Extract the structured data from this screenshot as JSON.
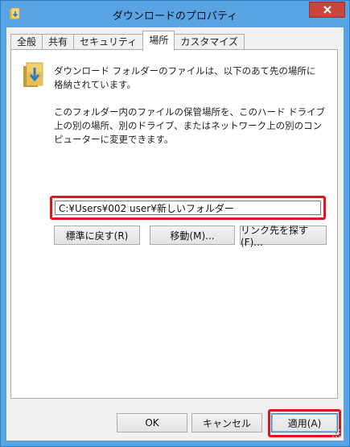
{
  "window": {
    "title": "ダウンロードのプロパティ"
  },
  "tabs": [
    {
      "label": "全般"
    },
    {
      "label": "共有"
    },
    {
      "label": "セキュリティ"
    },
    {
      "label": "場所"
    },
    {
      "label": "カスタマイズ"
    }
  ],
  "active_tab": "場所",
  "location": {
    "description": "ダウンロード フォルダーのファイルは、以下のあて先の場所に格納されています。",
    "help_text": "このフォルダー内のファイルの保管場所を、このハード ドライブ上の別の場所、別のドライブ、またはネットワーク上の別のコンピューターに変更できます。",
    "path_value": "C:¥Users¥002 user¥新しいフォルダー",
    "restore_default_label": "標準に戻す(R)",
    "move_label": "移動(M)...",
    "find_target_label": "リンク先を探す(F)..."
  },
  "footer": {
    "ok_label": "OK",
    "cancel_label": "キャンセル",
    "apply_label": "適用(A)"
  },
  "colors": {
    "titlebar": "#5aa3e3",
    "close_button": "#c9463d",
    "highlight": "#e0141e",
    "folder": "#e8c25a"
  }
}
